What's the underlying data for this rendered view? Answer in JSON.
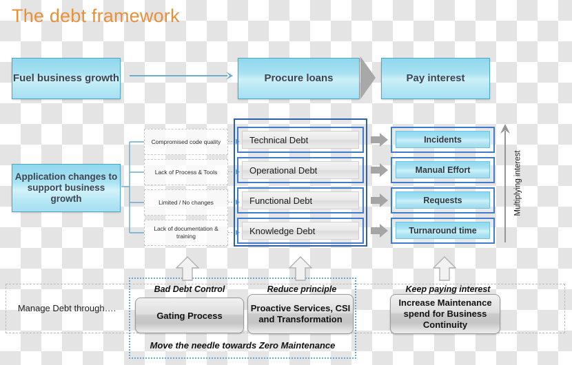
{
  "title": "The debt framework",
  "colors": {
    "title": "#e8903a",
    "cyan_box": "#a9e2f2",
    "frame_blue": "#2c5fa8",
    "row_blue": "#3f7ad1",
    "gray_arrow": "#a0a0a0",
    "dotted_blue": "#5fa8d8"
  },
  "top_flow": {
    "boxes": [
      {
        "label": "Fuel business growth"
      },
      {
        "label": "Procure loans"
      },
      {
        "label": "Pay interest"
      }
    ],
    "arrow_icon": "right-arrow-icon",
    "chevron_icon": "right-chevron-icon"
  },
  "driver": {
    "label": "Application changes to support business growth"
  },
  "causes": [
    {
      "label": "Compromised  code quality"
    },
    {
      "label": "Lack of Process & Tools"
    },
    {
      "label": "Limited  /  No changes"
    },
    {
      "label": "Lack of documentation  & training"
    }
  ],
  "debts": [
    {
      "label": "Technical Debt"
    },
    {
      "label": "Operational Debt"
    },
    {
      "label": "Functional Debt"
    },
    {
      "label": "Knowledge Debt"
    }
  ],
  "outcomes": [
    {
      "label": "Incidents"
    },
    {
      "label": "Manual Effort"
    },
    {
      "label": "Requests"
    },
    {
      "label": "Turnaround time"
    }
  ],
  "interest": {
    "label": "Multiplying interest",
    "arrow_icon": "up-arrow-icon"
  },
  "bottom": {
    "manage_label": "Manage Debt through….",
    "items": [
      {
        "caption": "Bad Debt Control",
        "action": "Gating Process"
      },
      {
        "caption": "Reduce principle",
        "action": "Proactive Services, CSI and Transformation"
      },
      {
        "caption": "Keep paying interest",
        "action": "Increase Maintenance spend for Business Continuity"
      }
    ],
    "footer": "Move the needle towards Zero Maintenance",
    "up_arrow_icon": "up-arrow-icon"
  }
}
